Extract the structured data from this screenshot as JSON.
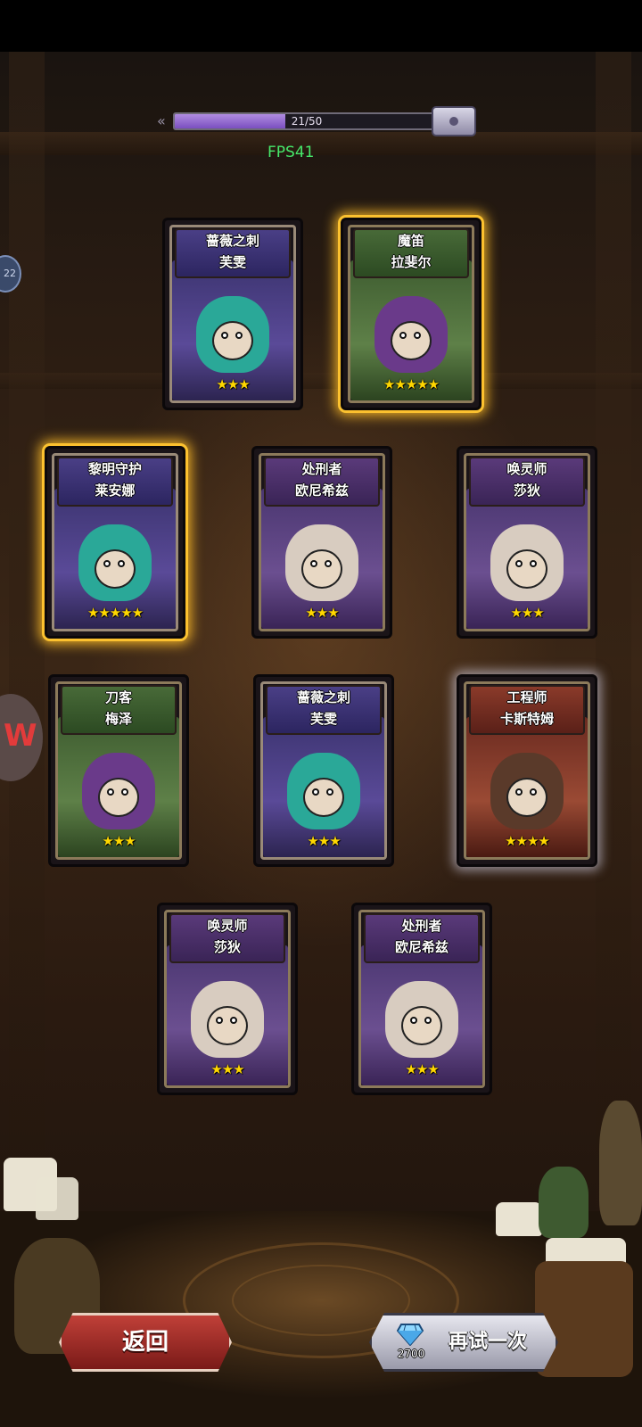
{
  "progress": {
    "text": "21/50",
    "current": 21,
    "max": 50
  },
  "fps_label": "FPS41",
  "side_bubble_text": "22",
  "cards": [
    {
      "line1": "蔷薇之刺",
      "line2": "芙雯",
      "stars": "★★★",
      "theme": "purple",
      "glow": "none"
    },
    {
      "line1": "魔笛",
      "line2": "拉斐尔",
      "stars": "★★★★★",
      "theme": "green",
      "glow": "gold"
    },
    {
      "line1": "黎明守护",
      "line2": "莱安娜",
      "stars": "★★★★★",
      "theme": "purple",
      "glow": "gold"
    },
    {
      "line1": "处刑者",
      "line2": "欧尼希兹",
      "stars": "★★★",
      "theme": "violet",
      "glow": "none"
    },
    {
      "line1": "唤灵师",
      "line2": "莎狄",
      "stars": "★★★",
      "theme": "violet",
      "glow": "none"
    },
    {
      "line1": "刀客",
      "line2": "梅泽",
      "stars": "★★★",
      "theme": "green",
      "glow": "none"
    },
    {
      "line1": "蔷薇之刺",
      "line2": "芙雯",
      "stars": "★★★",
      "theme": "purple",
      "glow": "none"
    },
    {
      "line1": "工程师",
      "line2": "卡斯特姆",
      "stars": "★★★★",
      "theme": "red",
      "glow": "silver"
    },
    {
      "line1": "唤灵师",
      "line2": "莎狄",
      "stars": "★★★",
      "theme": "violet",
      "glow": "none"
    },
    {
      "line1": "处刑者",
      "line2": "欧尼希兹",
      "stars": "★★★",
      "theme": "violet",
      "glow": "none"
    }
  ],
  "buttons": {
    "back_label": "返回",
    "retry_label": "再试一次",
    "retry_cost": "2700",
    "retry_cost_icon": "diamond-icon"
  },
  "colors": {
    "fps": "#46e86a",
    "progress_fill": "#9b6fd6",
    "gold_glow": "#ffbe28",
    "back_button": "#b23a32"
  }
}
